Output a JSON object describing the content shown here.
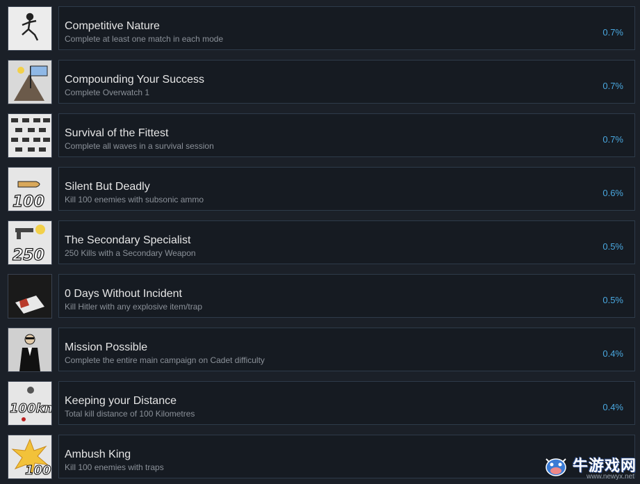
{
  "achievements": [
    {
      "title": "Competitive Nature",
      "desc": "Complete at least one match in each mode",
      "pct": "0.7%",
      "icon": "running-soldier-icon"
    },
    {
      "title": "Compounding Your Success",
      "desc": "Complete Overwatch 1",
      "pct": "0.7%",
      "icon": "flag-on-hill-icon"
    },
    {
      "title": "Survival of the Fittest",
      "desc": "Complete all waves in a survival session",
      "pct": "0.7%",
      "icon": "soldier-crowd-icon"
    },
    {
      "title": "Silent But Deadly",
      "desc": "Kill 100 enemies with subsonic ammo",
      "pct": "0.6%",
      "icon": "bullet-100-icon"
    },
    {
      "title": "The Secondary Specialist",
      "desc": "250 Kills with a Secondary Weapon",
      "pct": "0.5%",
      "icon": "pistol-250-icon"
    },
    {
      "title": "0 Days Without Incident",
      "desc": "Kill Hitler with any explosive item/trap",
      "pct": "0.5%",
      "icon": "explosion-paper-icon"
    },
    {
      "title": "Mission Possible",
      "desc": "Complete the entire main campaign on Cadet difficulty",
      "pct": "0.4%",
      "icon": "agent-tuxedo-icon"
    },
    {
      "title": "Keeping your Distance",
      "desc": "Total kill distance of 100 Kilometres",
      "pct": "0.4%",
      "icon": "distance-100km-icon"
    },
    {
      "title": "Ambush King",
      "desc": "Kill 100 enemies with traps",
      "pct": "",
      "icon": "trap-explosion-100-icon"
    }
  ],
  "watermark": {
    "cn": "牛游戏网",
    "url": "www.newyx.net"
  },
  "colors": {
    "background": "#1b2028",
    "card": "#161b22",
    "border": "#2e3b4a",
    "title": "#e6e6e6",
    "desc": "#8b9199",
    "pct": "#4aa8e0"
  }
}
